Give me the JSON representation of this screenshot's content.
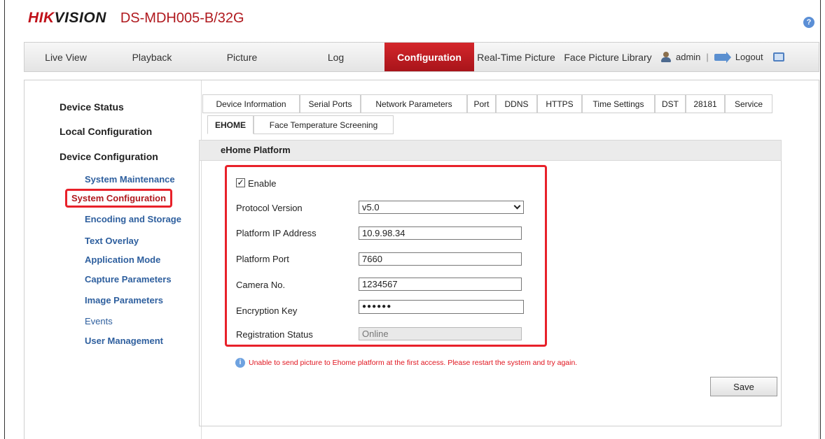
{
  "header": {
    "logo_part1": "HIK",
    "logo_part2": "VISION",
    "model": "DS-MDH005-B/32G",
    "help": "?"
  },
  "topnav": {
    "items": [
      "Live View",
      "Playback",
      "Picture",
      "Log",
      "Configuration",
      "Real-Time Picture",
      "Face Picture Library"
    ],
    "active": "Configuration",
    "user": "admin",
    "separator": "|",
    "logout": "Logout"
  },
  "sidebar": {
    "headings": [
      "Device Status",
      "Local Configuration",
      "Device Configuration"
    ],
    "items": [
      "System Maintenance",
      "System Configuration",
      "Encoding and Storage",
      "Text Overlay",
      "Application Mode",
      "Capture Parameters",
      "Image Parameters",
      "Events",
      "User Management"
    ],
    "active": "System Configuration"
  },
  "tabs": {
    "row1": [
      "Device Information",
      "Serial Ports",
      "Network Parameters",
      "Port",
      "DDNS",
      "HTTPS",
      "Time Settings",
      "DST",
      "28181",
      "Service"
    ],
    "row2": [
      "EHOME",
      "Face Temperature Screening"
    ],
    "active": "EHOME"
  },
  "form": {
    "section_title": "eHome Platform",
    "enable_label": "Enable",
    "enable_checked": true,
    "check_mark": "✓",
    "protocol_label": "Protocol Version",
    "protocol_value": "v5.0",
    "ip_label": "Platform IP Address",
    "ip_value": "10.9.98.34",
    "port_label": "Platform Port",
    "port_value": "7660",
    "camera_label": "Camera No.",
    "camera_value": "1234567",
    "key_label": "Encryption Key",
    "key_value": "●●●●●●",
    "status_label": "Registration Status",
    "status_value": "Online"
  },
  "notice": {
    "icon": "i",
    "text": "Unable to send picture to Ehome platform at the first access. Please restart the system and try again."
  },
  "actions": {
    "save": "Save"
  },
  "colors": {
    "brand_red": "#c0111a",
    "link_blue": "#2e5f9e",
    "highlight_red": "#e8212a"
  }
}
